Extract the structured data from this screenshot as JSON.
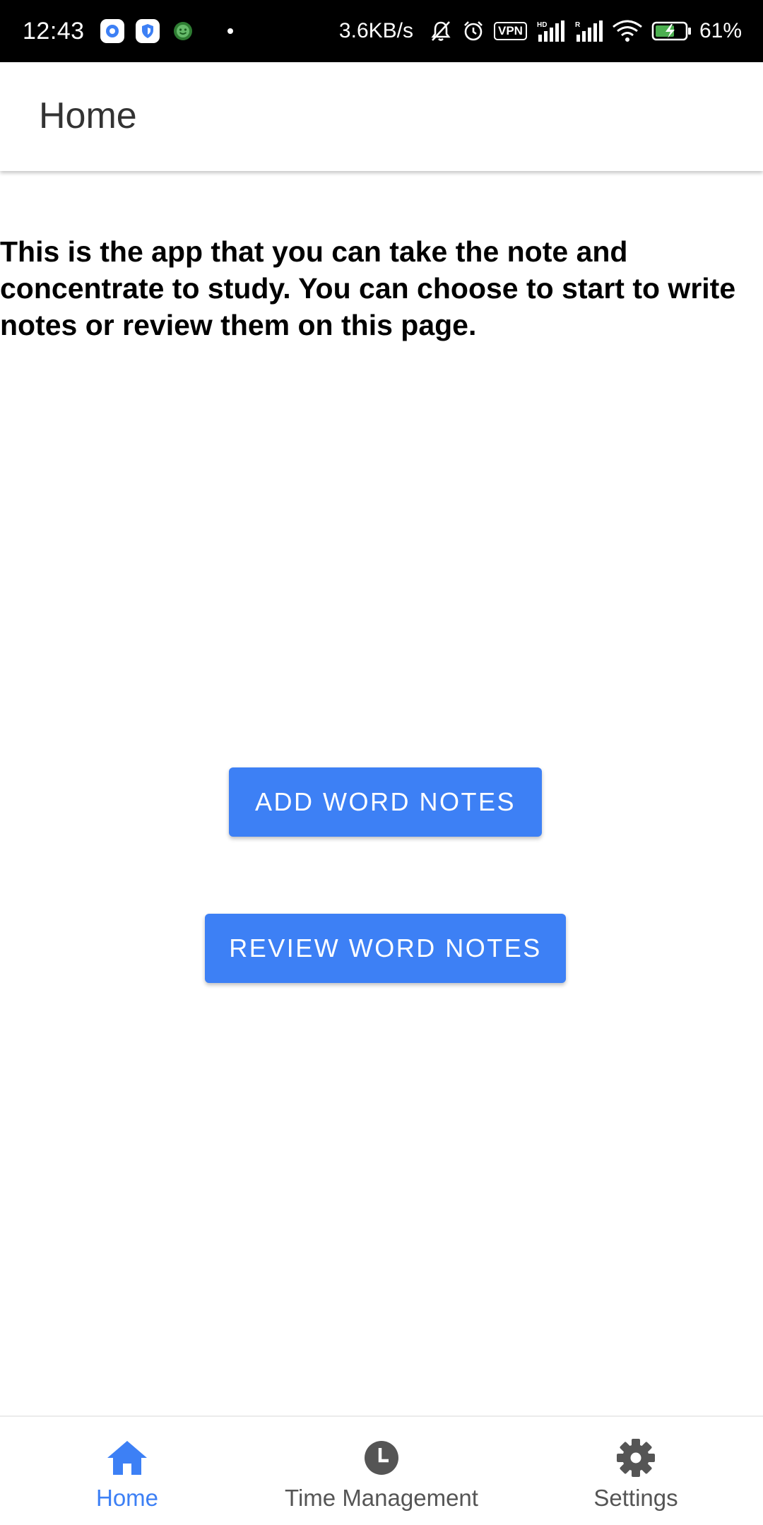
{
  "status_bar": {
    "time": "12:43",
    "network_speed": "3.6KB/s",
    "vpn_label": "VPN",
    "battery_percent": "61%",
    "icons": [
      "settings-app-icon",
      "shield-app-icon",
      "green-app-icon",
      "notification-dot",
      "mute-bell-icon",
      "alarm-icon",
      "vpn-icon",
      "hd-signal-icon",
      "signal-icon",
      "wifi-icon",
      "battery-charging-icon"
    ]
  },
  "app_bar": {
    "title": "Home"
  },
  "main": {
    "intro_text": "This is the app that you can take the note and concentrate to study. You can choose to start to write notes or review them on this page.",
    "add_button_label": "ADD WORD NOTES",
    "review_button_label": "REVIEW WORD NOTES"
  },
  "bottom_nav": {
    "items": [
      {
        "label": "Home",
        "icon": "home-icon",
        "active": true
      },
      {
        "label": "Time Management",
        "icon": "clock-icon",
        "active": false
      },
      {
        "label": "Settings",
        "icon": "gear-icon",
        "active": false
      }
    ]
  },
  "colors": {
    "accent": "#3d80f5",
    "status_bar_bg": "#000000",
    "inactive_icon": "#555555"
  }
}
